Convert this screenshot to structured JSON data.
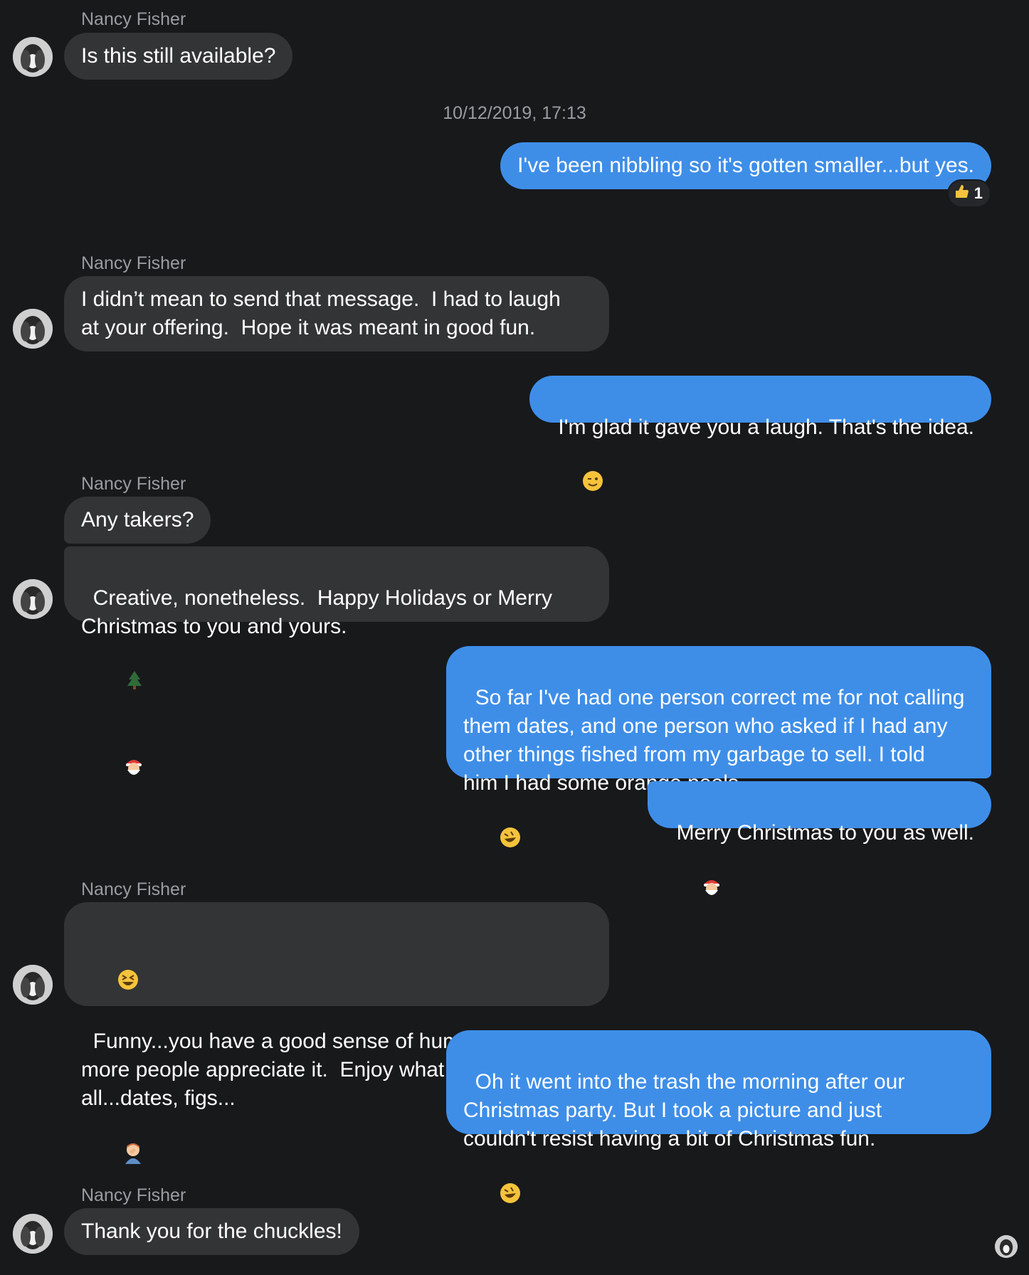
{
  "contact": {
    "name": "Nancy Fisher"
  },
  "timestamp": "10/12/2019, 17:13",
  "messages": {
    "m1": "Is this still available?",
    "m2": "I've been nibbling so it's gotten smaller...but yes.",
    "m2_reaction_count": "1",
    "m3": "I didn’t mean to send that message.  I had to laugh\nat your offering.  Hope it was meant in good fun.",
    "m4": "I'm glad it gave you a laugh. That's the idea.",
    "m5": "Any takers?",
    "m6": "Creative, nonetheless.  Happy Holidays or Merry\nChristmas to you and yours.",
    "m7": "So far I've had one person correct me for not calling\nthem dates, and one person who asked if I had any\nother things fished from my garbage to sell. I told\nhim I had some orange peels.",
    "m8": "Merry Christmas to you as well.",
    "m9_a": "Funny...you have a good sense of humor.  I hope\nmore people appreciate it.  Enjoy what remains of it\nall...dates, figs...",
    "m10": "Oh it went into the trash the morning after our\nChristmas party. But I took a picture and just\ncouldn't resist having a bit of Christmas fun.",
    "m11": "Thank you for the chuckles!"
  },
  "icons": {
    "reaction": "thumbs-up-icon",
    "wink": "wink-emoji-icon",
    "tree": "christmas-tree-emoji-icon",
    "santa": "santa-emoji-icon",
    "rofl": "rofl-emoji-icon",
    "laugh": "laughing-emoji-icon",
    "facepalm": "facepalm-emoji-icon"
  },
  "colors": {
    "background": "#18191b",
    "incoming": "#333436",
    "outgoing": "#3e8ee8"
  }
}
